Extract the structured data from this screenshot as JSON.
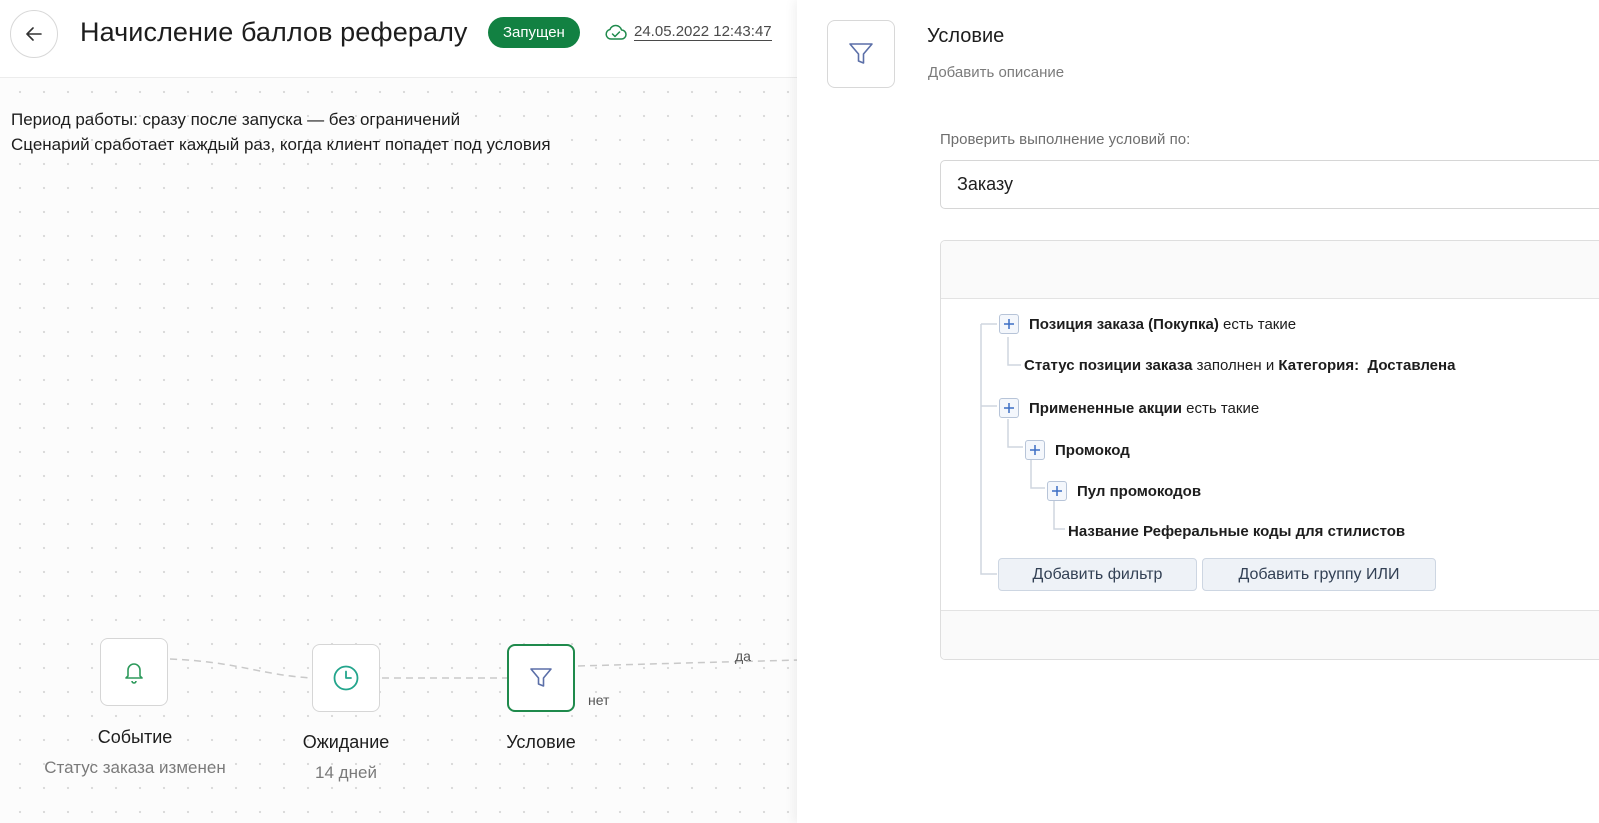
{
  "header": {
    "title": "Начисление баллов рефералу",
    "status": "Запущен",
    "saved_at": "24.05.2022 12:43:47",
    "status_color": "#128142"
  },
  "scenario_info": {
    "period": "Период работы: сразу после запуска — без ограничений",
    "trigger": "Сценарий сработает каждый раз, когда клиент попадет под условия"
  },
  "flow": {
    "nodes": [
      {
        "label": "Событие",
        "sublabel": "Статус заказа изменен",
        "icon": "bell-icon"
      },
      {
        "label": "Ожидание",
        "sublabel": "14 дней",
        "icon": "clock-icon"
      },
      {
        "label": "Условие",
        "sublabel": "",
        "icon": "funnel-icon"
      }
    ],
    "branch_yes": "да",
    "branch_no": "нет"
  },
  "panel": {
    "title": "Условие",
    "description_placeholder": "Добавить описание",
    "check_by_label": "Проверить выполнение условий по:",
    "check_by_value": "Заказу",
    "filters": [
      {
        "bold": "Позиция заказа (Покупка)",
        "rest": " есть такие"
      },
      {
        "bold": "Статус позиции заказа",
        "mid": " заполнен и ",
        "bold2": "Категория:  Доставлена"
      },
      {
        "bold": "Примененные акции",
        "rest": " есть такие"
      },
      {
        "bold": "Промокод"
      },
      {
        "bold": "Пул промокодов"
      },
      {
        "bold": "Название Реферальные коды для стилистов"
      }
    ],
    "add_filter_label": "Добавить фильтр",
    "add_or_group_label": "Добавить группу ИЛИ"
  }
}
